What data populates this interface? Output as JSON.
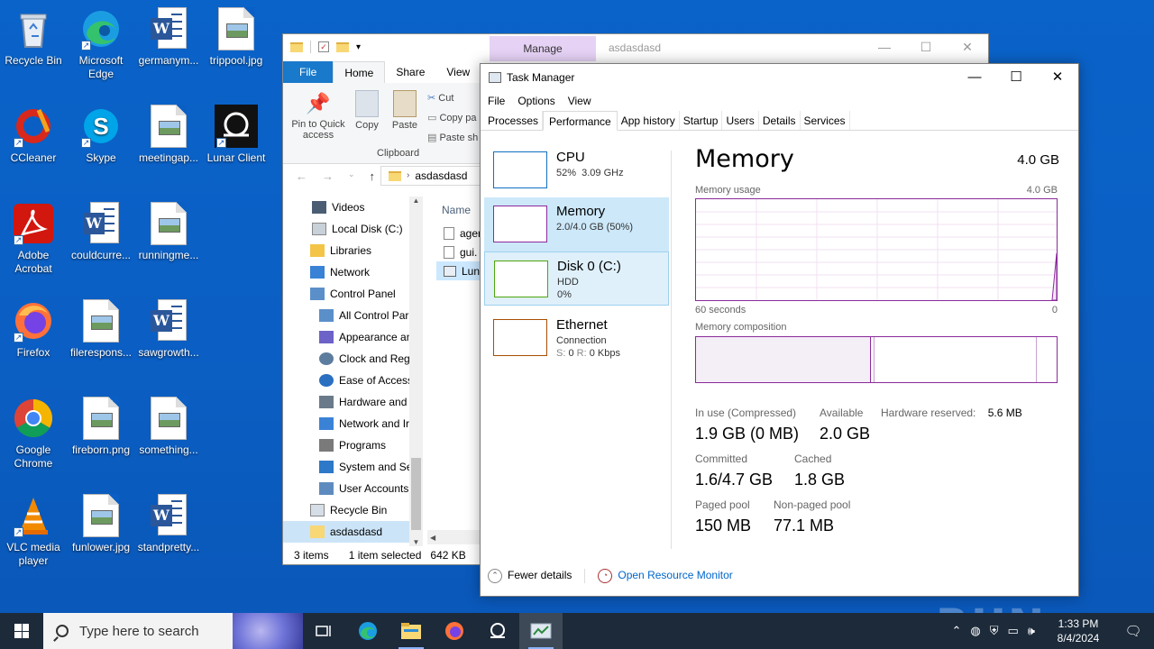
{
  "desktop": {
    "icons": [
      {
        "label": "Recycle Bin"
      },
      {
        "label": "Microsoft Edge"
      },
      {
        "label": "germanym..."
      },
      {
        "label": "trippool.jpg"
      },
      {
        "label": "CCleaner"
      },
      {
        "label": "Skype"
      },
      {
        "label": "meetingap..."
      },
      {
        "label": "Lunar Client"
      },
      {
        "label": "Adobe Acrobat"
      },
      {
        "label": "couldcurre..."
      },
      {
        "label": "runningme..."
      },
      {
        "label": "Firefox"
      },
      {
        "label": "filerespons..."
      },
      {
        "label": "sawgrowth..."
      },
      {
        "label": "Google Chrome"
      },
      {
        "label": "fireborn.png"
      },
      {
        "label": "something..."
      },
      {
        "label": "VLC media player"
      },
      {
        "label": "funlower.jpg"
      },
      {
        "label": "standpretty..."
      }
    ]
  },
  "explorer": {
    "manage_tab": "Manage",
    "title": "asdasdasd",
    "tabs": {
      "file": "File",
      "home": "Home",
      "share": "Share",
      "view": "View"
    },
    "ribbon": {
      "pin": "Pin to Quick access",
      "copy": "Copy",
      "paste": "Paste",
      "cut": "Cut",
      "copy_path": "Copy pa",
      "paste_shortcut": "Paste sh",
      "group": "Clipboard"
    },
    "address": "asdasdasd",
    "tree": [
      "Videos",
      "Local Disk (C:)",
      "Libraries",
      "Network",
      "Control Panel",
      "All Control Par",
      "Appearance an",
      "Clock and Regi",
      "Ease of Access",
      "Hardware and",
      "Network and Ir",
      "Programs",
      "System and Se",
      "User Accounts",
      "Recycle Bin",
      "asdasdasd"
    ],
    "files_header": "Name",
    "files": [
      "ager",
      "gui.",
      "Luna"
    ],
    "status": {
      "items": "3 items",
      "selected": "1 item selected",
      "size": "642 KB"
    }
  },
  "taskmgr": {
    "title": "Task Manager",
    "menu": [
      "File",
      "Options",
      "View"
    ],
    "tabs": [
      "Processes",
      "Performance",
      "App history",
      "Startup",
      "Users",
      "Details",
      "Services"
    ],
    "side": {
      "cpu": {
        "name": "CPU",
        "line2": "52%  3.09 GHz"
      },
      "memory": {
        "name": "Memory",
        "line2": "2.0/4.0 GB (50%)"
      },
      "disk": {
        "name": "Disk 0 (C:)",
        "line2": "HDD",
        "line3": "0%"
      },
      "ethernet": {
        "name": "Ethernet",
        "line2": "Connection",
        "line3_s": "S:",
        "line3_s_val": "0",
        "line3_r": "R:",
        "line3_r_val": "0 Kbps"
      }
    },
    "main": {
      "title": "Memory",
      "total": "4.0 GB",
      "usage_label": "Memory usage",
      "usage_max": "4.0 GB",
      "axis_left": "60 seconds",
      "axis_right": "0",
      "composition_label": "Memory composition",
      "in_use_label": "In use (Compressed)",
      "in_use_value": "1.9 GB (0 MB)",
      "available_label": "Available",
      "available_value": "2.0 GB",
      "hw_reserved_label": "Hardware reserved:",
      "hw_reserved_value": "5.6 MB",
      "committed_label": "Committed",
      "committed_value": "1.6/4.7 GB",
      "cached_label": "Cached",
      "cached_value": "1.8 GB",
      "paged_label": "Paged pool",
      "paged_value": "150 MB",
      "nonpaged_label": "Non-paged pool",
      "nonpaged_value": "77.1 MB"
    },
    "footer": {
      "fewer": "Fewer details",
      "monitor": "Open Resource Monitor"
    }
  },
  "watermark": "ANY RUN",
  "taskbar": {
    "search_placeholder": "Type here to search",
    "time": "1:33 PM",
    "date": "8/4/2024"
  },
  "colors": {
    "memory_accent": "#8b2a9c",
    "cpu_accent": "#1170c4",
    "disk_accent": "#4da60c",
    "ethernet_accent": "#a74f01",
    "file_tab": "#1979ca"
  }
}
